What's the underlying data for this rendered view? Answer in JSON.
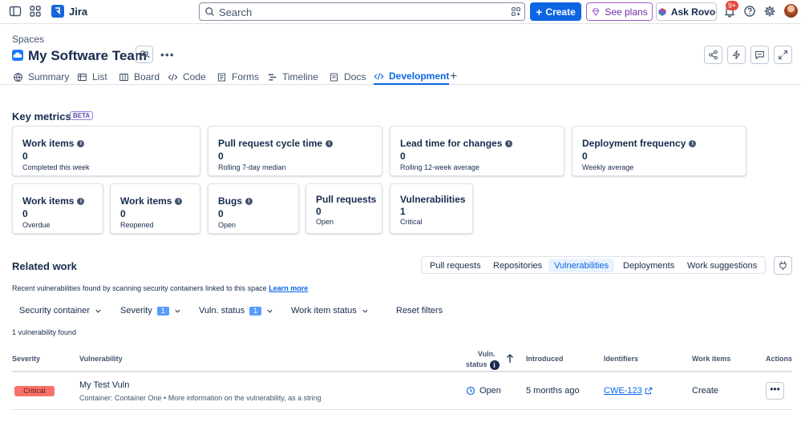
{
  "topbar": {
    "app_name": "Jira",
    "search_placeholder": "Search",
    "create_label": "Create",
    "plans_label": "See plans",
    "rovo_label": "Ask Rovo",
    "notifications_badge": "9+"
  },
  "space": {
    "breadcrumb": "Spaces",
    "title": "My Software Team"
  },
  "tabs": [
    {
      "label": "Summary",
      "icon": "globe-icon"
    },
    {
      "label": "List",
      "icon": "list-icon"
    },
    {
      "label": "Board",
      "icon": "board-icon"
    },
    {
      "label": "Code",
      "icon": "code-icon"
    },
    {
      "label": "Forms",
      "icon": "forms-icon"
    },
    {
      "label": "Timeline",
      "icon": "timeline-icon"
    },
    {
      "label": "Docs",
      "icon": "docs-icon"
    },
    {
      "label": "Development",
      "icon": "development-icon",
      "active": true
    }
  ],
  "key_metrics": {
    "title": "Key metrics",
    "badge": "BETA",
    "cards": [
      {
        "title": "Work items",
        "value": "0",
        "subtitle": "Completed this week",
        "info": true
      },
      {
        "title": "Pull request cycle time",
        "value": "0",
        "subtitle": "Rolling 7-day median",
        "info": true
      },
      {
        "title": "Lead time for changes",
        "value": "0",
        "subtitle": "Rolling 12-week average",
        "info": true
      },
      {
        "title": "Deployment frequency",
        "value": "0",
        "subtitle": "Weekly average",
        "info": true
      },
      {
        "title": "Work items",
        "value": "0",
        "subtitle": "Overdue",
        "info": true
      },
      {
        "title": "Work items",
        "value": "0",
        "subtitle": "Reopened",
        "info": true
      },
      {
        "title": "Bugs",
        "value": "0",
        "subtitle": "Open",
        "info": true
      },
      {
        "title": "Pull requests",
        "value": "0",
        "subtitle": "Open",
        "info": false
      },
      {
        "title": "Vulnerabilities",
        "value": "1",
        "subtitle": "Critical",
        "info": false
      }
    ]
  },
  "related_work": {
    "title": "Related work",
    "segments": [
      "Pull requests",
      "Repositories",
      "Vulnerabilities",
      "Deployments",
      "Work suggestions"
    ],
    "active_segment": "Vulnerabilities",
    "description": "Recent vulnerabilities found by scanning security containers linked to this space",
    "learn_more": "Learn more",
    "filters": {
      "security_container": "Security container",
      "severity": "Severity",
      "severity_count": "1",
      "vuln_status": "Vuln. status",
      "vuln_status_count": "1",
      "work_item_status": "Work item status",
      "reset": "Reset filters"
    },
    "found_text": "1 vulnerability found"
  },
  "table": {
    "headers": {
      "severity": "Severity",
      "vulnerability": "Vulnerability",
      "vuln_status_1": "Vuln.",
      "vuln_status_2": "status",
      "introduced": "Introduced",
      "identifiers": "Identifiers",
      "work_items": "Work items",
      "actions": "Actions"
    },
    "rows": [
      {
        "severity": "Critical",
        "name": "My Test Vuln",
        "detail": "Container: Container One • More information on the vulnerability, as a string",
        "status": "Open",
        "introduced": "5 months ago",
        "identifier": "CWE-123",
        "work_items": "Create",
        "actions": "•••"
      }
    ]
  },
  "colors": {
    "primary": "#0c66e4",
    "critical": "#f87168",
    "plans": "#6e2fa4"
  }
}
